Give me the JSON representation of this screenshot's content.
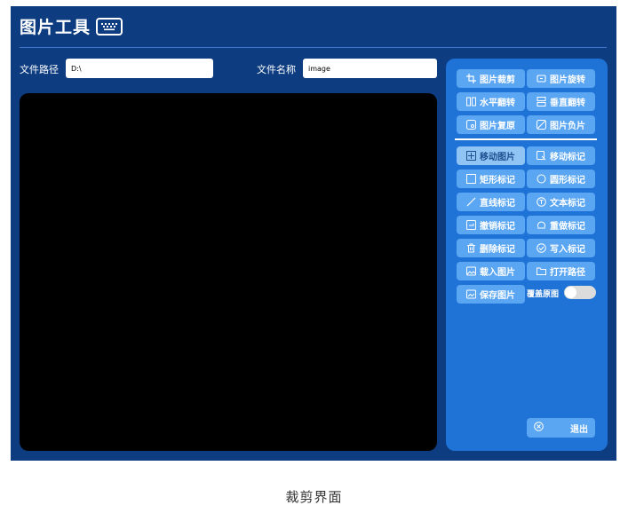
{
  "app": {
    "title": "图片工具"
  },
  "fields": {
    "path_label": "文件路径",
    "path_value": "D:\\",
    "name_label": "文件名称",
    "name_value": "image"
  },
  "buttons": {
    "crop": "图片裁剪",
    "rotate": "图片旋转",
    "flip_h": "水平翻转",
    "flip_v": "垂直翻转",
    "restore": "图片复原",
    "negative": "图片负片",
    "move_image": "移动图片",
    "move_mark": "移动标记",
    "rect_mark": "矩形标记",
    "circle_mark": "圆形标记",
    "line_mark": "直线标记",
    "text_mark": "文本标记",
    "undo_mark": "撤销标记",
    "redo_mark": "重做标记",
    "delete_mark": "删除标记",
    "write_mark": "写入标记",
    "load_image": "载入图片",
    "open_path": "打开路径",
    "save_image": "保存图片"
  },
  "overwrite": {
    "label": "覆盖原图",
    "enabled": false
  },
  "exit_label": "退出",
  "caption": "裁剪界面",
  "colors": {
    "app_bg": "#0d3d80",
    "panel_bg": "#1f73d6",
    "button_bg": "#5aa6f2",
    "active_button_bg": "#8fc4f5"
  }
}
